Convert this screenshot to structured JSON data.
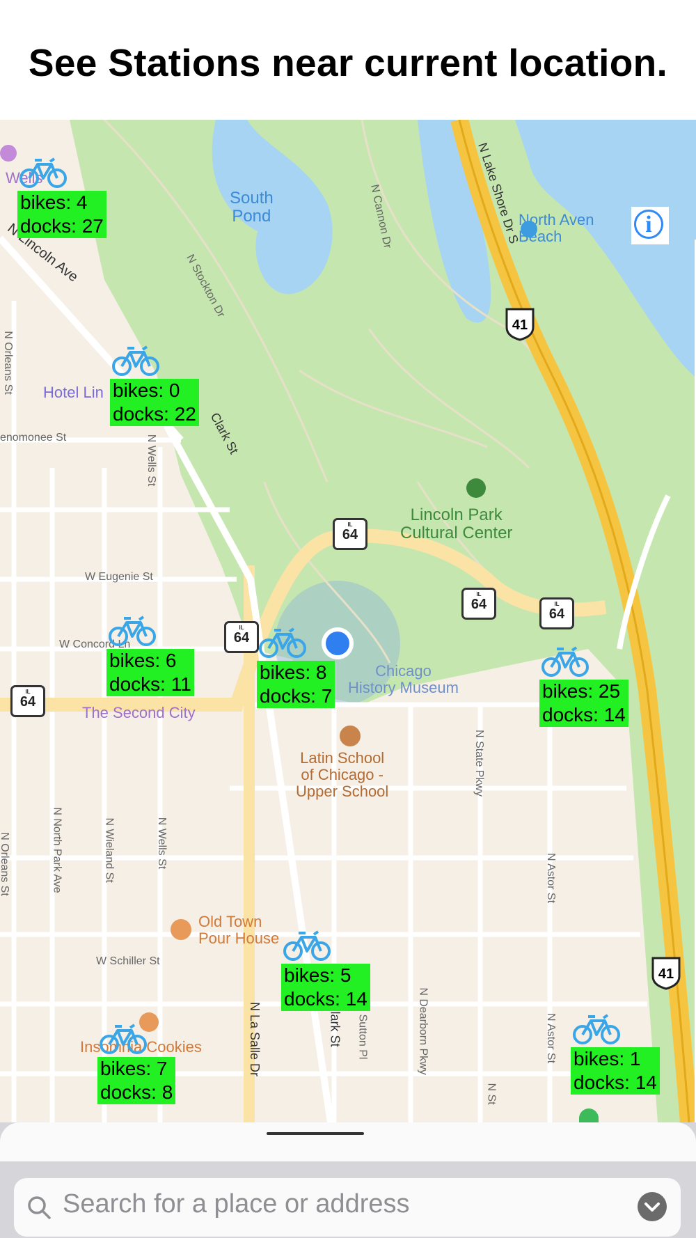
{
  "headline": "See Stations near current location.",
  "map": {
    "places": {
      "south_pond": "South\nPond",
      "north_ave_beach": "North Aven\nBeach",
      "lincoln_park_cultural_center": "Lincoln Park\nCultural Center",
      "chicago_history_museum_partial": "Chicago\nHistory Museum",
      "latin_school": "Latin School\nof Chicago -\nUpper School",
      "old_town_pour_house": "Old Town\nPour House",
      "insomnia_cookies": "Insomnia Cookies",
      "the_second_city": "The Second City",
      "hotel_lincoln": "Hotel Lin",
      "wells": "Wells"
    },
    "streets": {
      "n_lake_shore": "N Lake Shore Dr S",
      "n_cannon": "N Cannon Dr",
      "n_stockton": "N Stockton Dr",
      "n_lincoln": "N Lincoln Ave",
      "n_orleans_top": "N Orleans St",
      "menomonee": "enomonee St",
      "n_wells_top": "N Wells St",
      "clark_top": "Clark St",
      "w_eugenie": "W Eugenie St",
      "w_concord": "W Concord Ln",
      "n_state": "N State Pkwy",
      "n_north_park": "N North Park Ave",
      "n_wieland": "N Wieland St",
      "n_wells_bottom": "N Wells St",
      "n_orleans_bottom": "N Orleans St",
      "n_astor_mid": "N Astor St",
      "w_schiller": "W Schiller St",
      "n_la_salle": "N La Salle Dr",
      "n_clark_bottom": "N Clark St",
      "n_sutton": "N Sutton Pl",
      "n_dearborn": "N Dearborn Pkwy",
      "n_astor_bottom": "N Astor St",
      "n_st": "N St"
    },
    "shields": {
      "il64": "64",
      "il_prefix": "IL",
      "us41": "41"
    },
    "stations": [
      {
        "bikes": "bikes: 4",
        "docks": "docks: 27"
      },
      {
        "bikes": "bikes: 0",
        "docks": "docks: 22"
      },
      {
        "bikes": "bikes: 6",
        "docks": "docks: 11"
      },
      {
        "bikes": "bikes: 8",
        "docks": "docks: 7"
      },
      {
        "bikes": "bikes: 25",
        "docks": "docks: 14"
      },
      {
        "bikes": "bikes: 5",
        "docks": "docks: 14"
      },
      {
        "bikes": "bikes: 7",
        "docks": "docks: 8"
      },
      {
        "bikes": "bikes: 1",
        "docks": "docks: 14"
      }
    ],
    "info_icon": "i"
  },
  "search": {
    "placeholder": "Search for a place or address"
  },
  "colors": {
    "park": "#c6e6b0",
    "water": "#a6d4f2",
    "land": "#f5efe6",
    "highway": "#f5c542",
    "station_box": "#22f022",
    "bike_icon": "#3aa6e8",
    "user_location": "#2f7ff0"
  }
}
